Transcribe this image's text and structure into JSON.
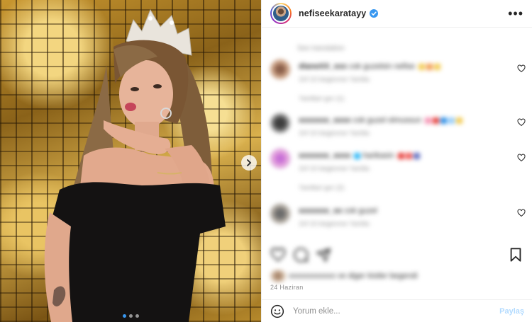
{
  "header": {
    "username": "nefiseekaratayy",
    "verified": true,
    "more_icon": "more-horizontal-icon"
  },
  "carousel": {
    "total_slides": 3,
    "active_slide": 1
  },
  "comments": {
    "see_translation": "See translation",
    "items": [
      {
        "user": "dianeXX_xxx",
        "text": "cok guzelsin nefise",
        "meta": "1hf  10 begenme  Yanitla",
        "reply": "Yanitlari gor (1)"
      },
      {
        "user": "xxxxxxx_xxxx",
        "text": "cok guzel olmussun",
        "meta": "1hf  10 begenme  Yanitla",
        "reply": ""
      },
      {
        "user": "xxxxxxx_xxxx",
        "text": "harikasin",
        "meta": "1hf  10 begenme  Yanitla",
        "reply": "Yanitlari gor (2)"
      },
      {
        "user": "xxxxxxx_xx",
        "text": "cok guzel",
        "meta": "1hf  10 begenme  Yanitla",
        "reply": ""
      }
    ]
  },
  "likes_text": "xxxxxxxxxxxx ve diger kisiler begendi",
  "post_date": "24 Haziran",
  "composer": {
    "placeholder": "Yorum ekle...",
    "post_label": "Paylaş"
  },
  "colors": {
    "verified_blue": "#3897f0",
    "post_button_disabled": "#b3dbff",
    "meta_gray": "#8e8e8e"
  }
}
